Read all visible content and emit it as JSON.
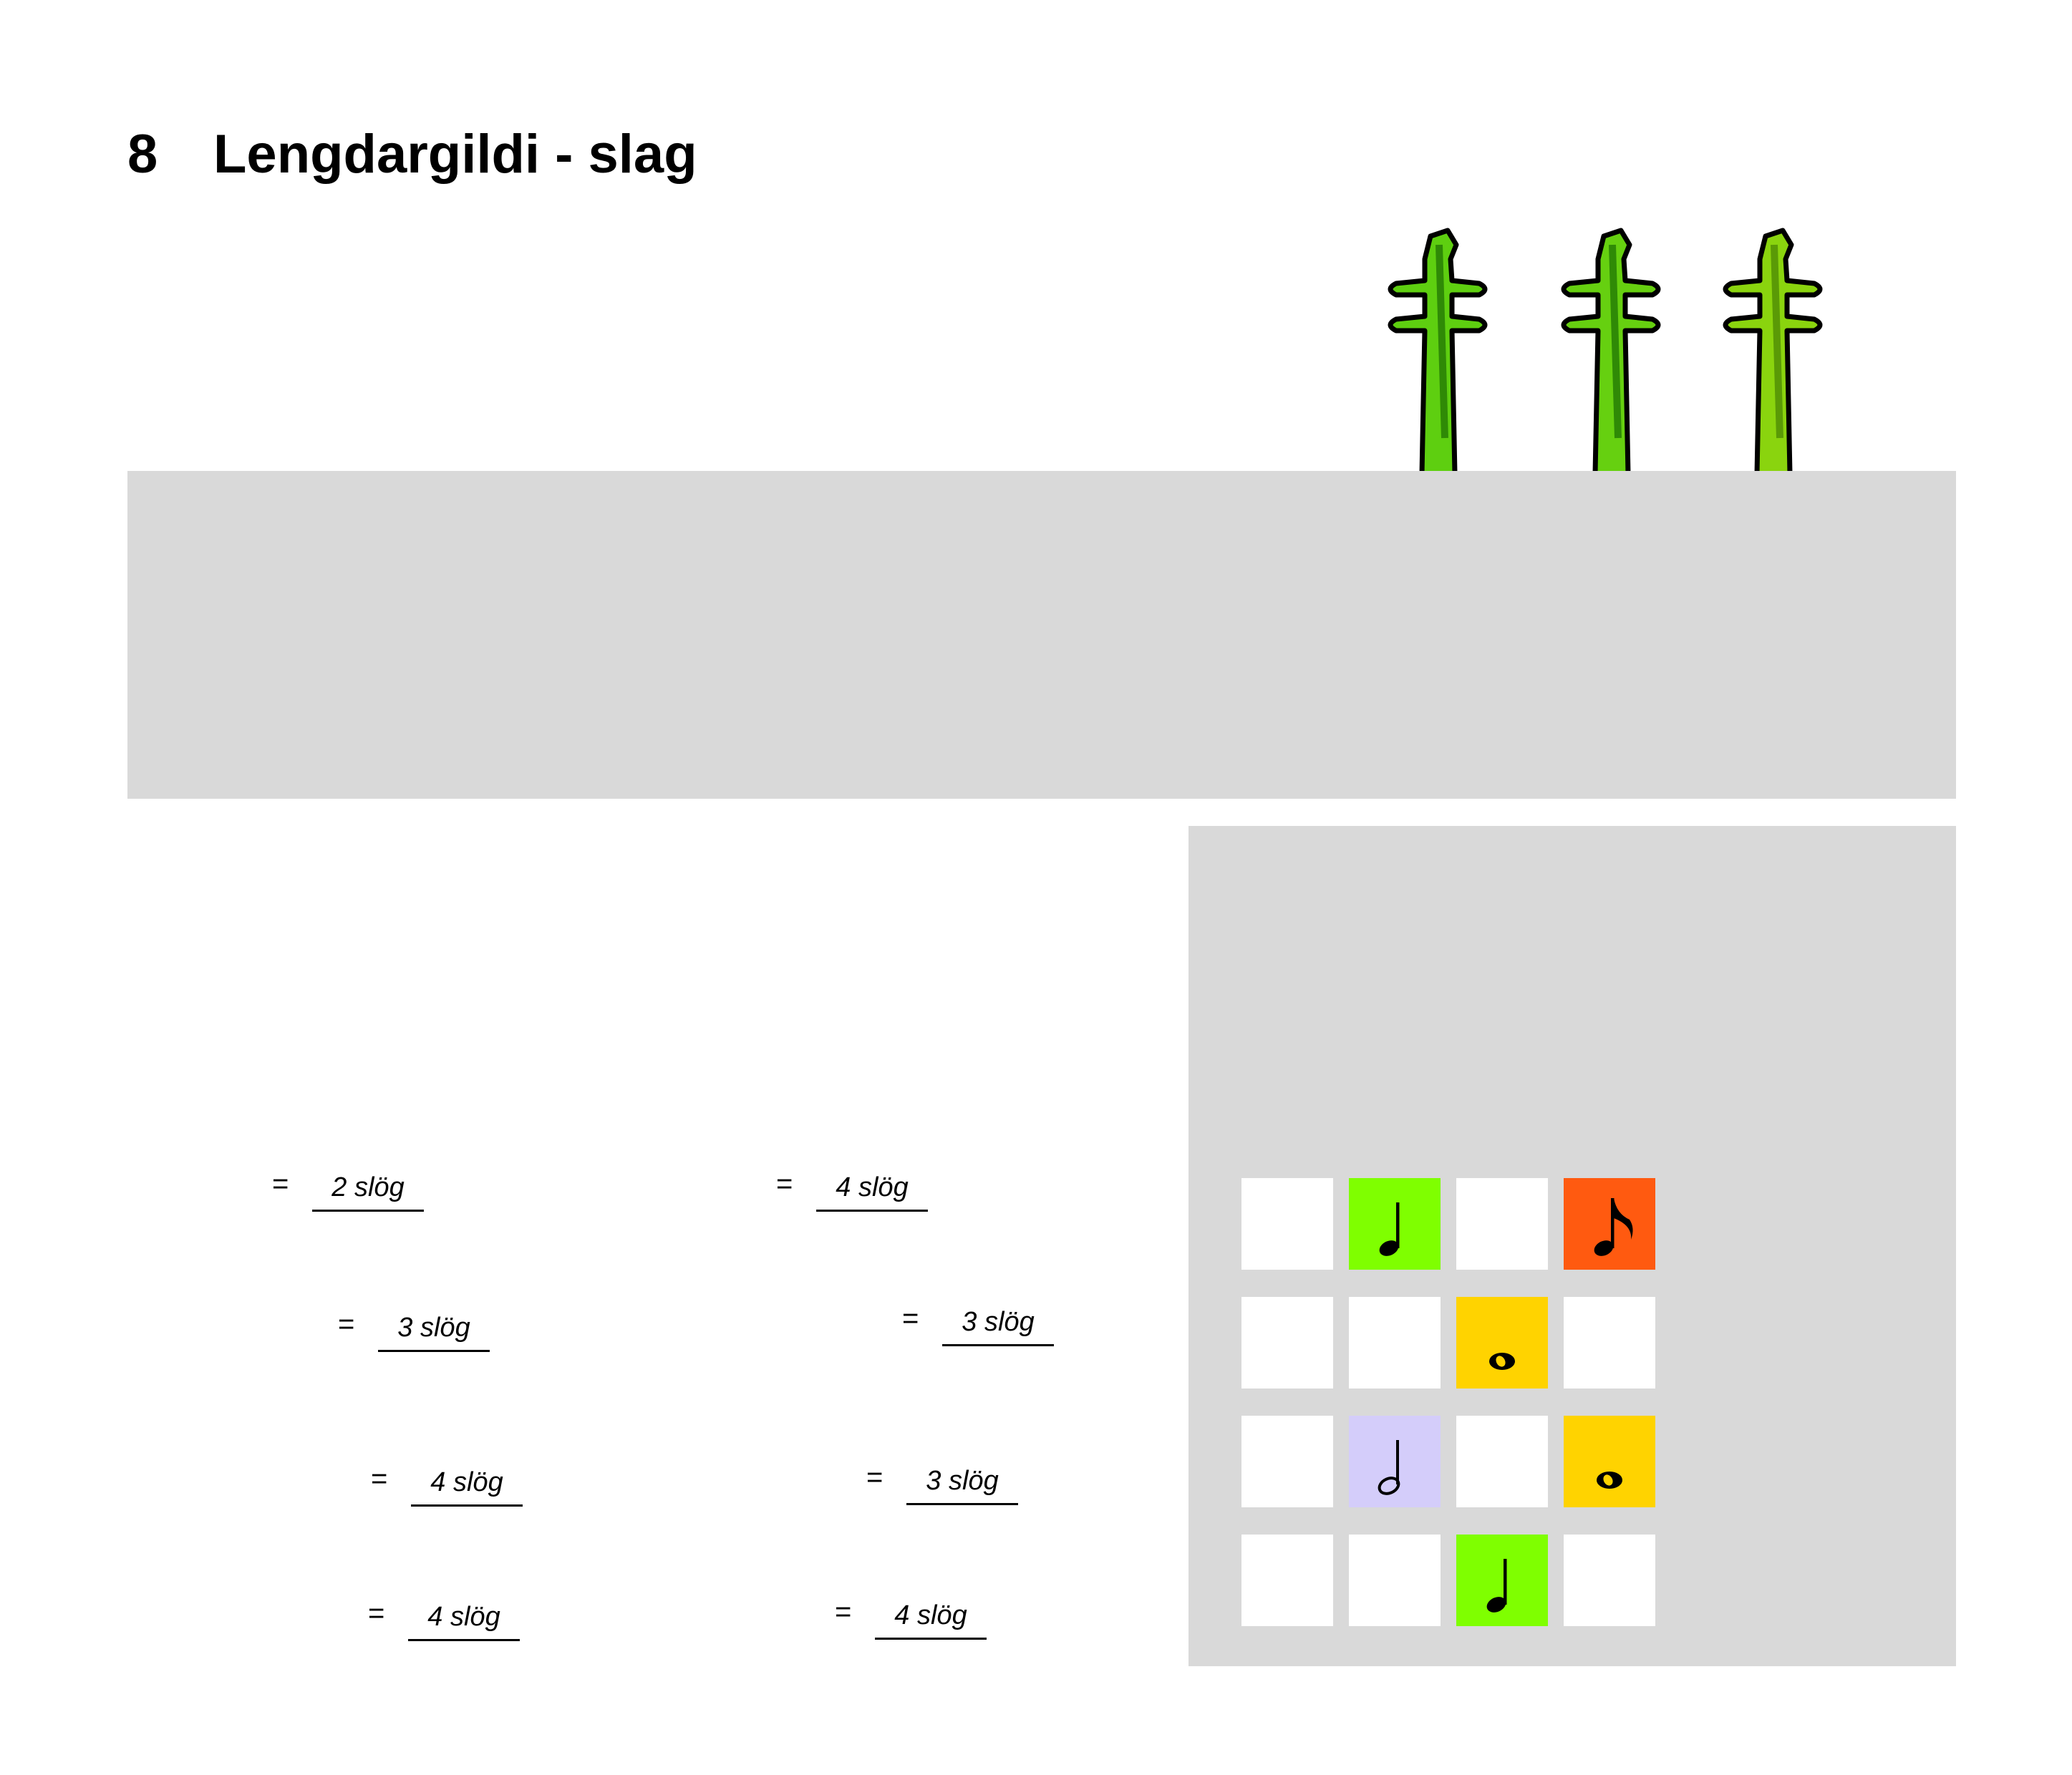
{
  "page": {
    "chapter_number": "8",
    "chapter_title": "Lengdargildi - slag"
  },
  "decoration": {
    "scroll_icon": "violin-scroll-icon",
    "scroll_colors": [
      "#5ecf10",
      "#66d010",
      "#8ad40e"
    ]
  },
  "panels": {
    "background_color": "#d9d9d9"
  },
  "exercises": {
    "left_column": [
      {
        "sign": "=",
        "answer": "2 slög"
      },
      {
        "sign": "=",
        "answer": "3 slög"
      },
      {
        "sign": "=",
        "answer": "4 slög"
      },
      {
        "sign": "=",
        "answer": "4 slög"
      }
    ],
    "right_column": [
      {
        "sign": "=",
        "answer": "4 slög"
      },
      {
        "sign": "=",
        "answer": "3 slög"
      },
      {
        "sign": "=",
        "answer": "3 slög"
      },
      {
        "sign": "=",
        "answer": "4 slög"
      }
    ]
  },
  "note_grid": {
    "cells": [
      {
        "color": "#ffffff",
        "note": ""
      },
      {
        "color": "#7fff00",
        "note": "quarter-note-icon"
      },
      {
        "color": "#ffffff",
        "note": ""
      },
      {
        "color": "#ff5a10",
        "note": "eighth-note-icon"
      },
      {
        "color": "#ffffff",
        "note": ""
      },
      {
        "color": "#ffffff",
        "note": ""
      },
      {
        "color": "#ffd300",
        "note": "whole-note-icon"
      },
      {
        "color": "#ffffff",
        "note": ""
      },
      {
        "color": "#ffffff",
        "note": ""
      },
      {
        "color": "#d4cdfa",
        "note": "half-note-icon"
      },
      {
        "color": "#ffffff",
        "note": ""
      },
      {
        "color": "#ffd300",
        "note": "whole-note-icon"
      },
      {
        "color": "#ffffff",
        "note": ""
      },
      {
        "color": "#ffffff",
        "note": ""
      },
      {
        "color": "#7fff00",
        "note": "quarter-note-icon"
      },
      {
        "color": "#ffffff",
        "note": ""
      }
    ]
  }
}
